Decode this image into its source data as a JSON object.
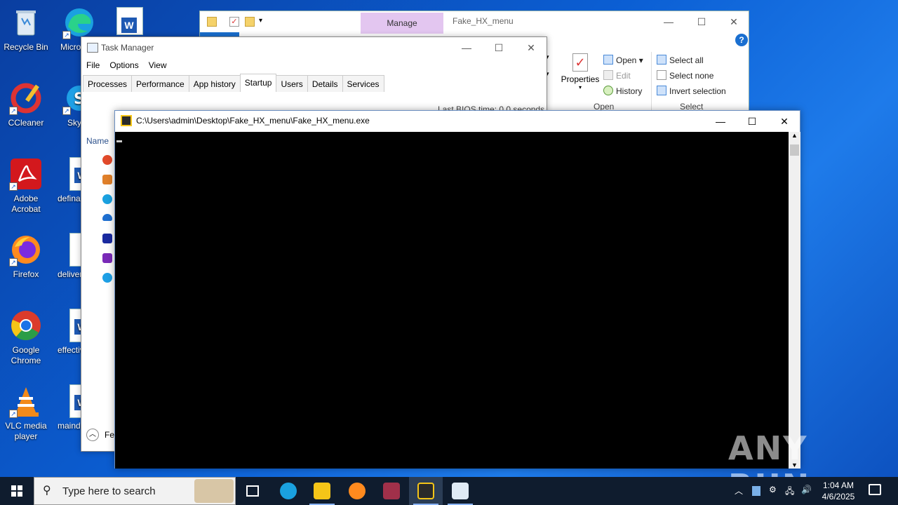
{
  "desktop": {
    "icons": [
      {
        "label": "Recycle Bin"
      },
      {
        "label": "CCleaner"
      },
      {
        "label": "Adobe Acrobat"
      },
      {
        "label": "Firefox"
      },
      {
        "label": "Google Chrome"
      },
      {
        "label": "VLC media player"
      },
      {
        "label": "Micro Edg"
      },
      {
        "label": "Sky"
      },
      {
        "label": "defina"
      },
      {
        "label": "deliver"
      },
      {
        "label": "effectiv"
      },
      {
        "label": "mainde"
      }
    ]
  },
  "explorer": {
    "title": "Fake_HX_menu",
    "manage_tab": "Manage",
    "ribbon": {
      "properties": "Properties",
      "open": "Open",
      "edit": "Edit",
      "history": "History",
      "select_all": "Select all",
      "select_none": "Select none",
      "invert_selection": "Invert selection",
      "group_open": "Open",
      "group_select": "Select"
    }
  },
  "taskmgr": {
    "title": "Task Manager",
    "menu": [
      "File",
      "Options",
      "View"
    ],
    "tabs": [
      "Processes",
      "Performance",
      "App history",
      "Startup",
      "Users",
      "Details",
      "Services"
    ],
    "active_tab": "Startup",
    "bios_label": "Last BIOS time:",
    "bios_value": "0.0 seconds",
    "column_name": "Name",
    "fewer_details": "Fe"
  },
  "console": {
    "title": "C:\\Users\\admin\\Desktop\\Fake_HX_menu\\Fake_HX_menu.exe"
  },
  "taskbar": {
    "search_placeholder": "Type here to search",
    "time": "1:04 AM",
    "date": "4/6/2025"
  },
  "watermark": "ANY RUN",
  "colors": {
    "desktop_bg": "#0b5fd4",
    "console_bg": "#000000",
    "manage_tab": "#e3c6f0",
    "taskbar": "#0f1c2e"
  }
}
